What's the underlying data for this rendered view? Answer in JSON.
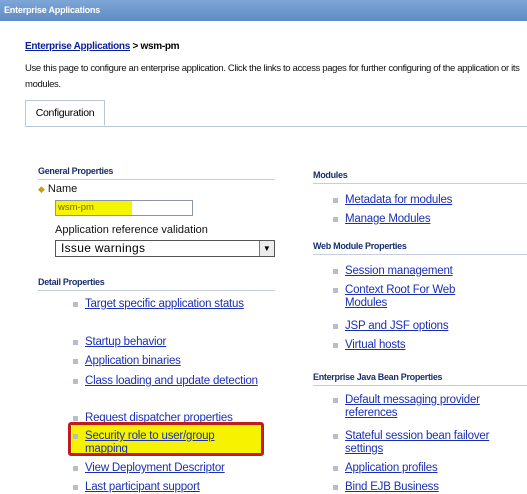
{
  "window": {
    "title": "Enterprise Applications"
  },
  "breadcrumb": {
    "link": "Enterprise Applications",
    "separator": " > ",
    "current": "wsm-pm"
  },
  "intro": "Use this page to configure an enterprise application. Click the links to access pages for further configuring of the application or its modules.",
  "tabs": [
    {
      "label": "Configuration"
    }
  ],
  "general": {
    "heading": "General Properties",
    "name_label": "Name",
    "name_value": "wsm-pm",
    "validation_label": "Application reference validation",
    "validation_value": "Issue warnings"
  },
  "detail": {
    "heading": "Detail Properties",
    "items": [
      {
        "label": "Target specific application status"
      },
      {
        "label": "Startup behavior"
      },
      {
        "label": "Application binaries"
      },
      {
        "label": "Class loading and update detection"
      },
      {
        "label": "Request dispatcher properties"
      },
      {
        "label": "Security role to user/group mapping"
      },
      {
        "label": "View Deployment Descriptor"
      },
      {
        "label": "Last participant support"
      }
    ]
  },
  "modules": {
    "heading": "Modules",
    "items": [
      {
        "label": "Metadata for modules"
      },
      {
        "label": "Manage Modules"
      }
    ]
  },
  "web_module": {
    "heading": "Web Module Properties",
    "items": [
      {
        "label": "Session management"
      },
      {
        "label": "Context Root For Web Modules"
      },
      {
        "label": "JSP and JSF options"
      },
      {
        "label": "Virtual hosts"
      }
    ]
  },
  "ejb": {
    "heading": "Enterprise Java Bean Properties",
    "items": [
      {
        "label": "Default messaging provider references"
      },
      {
        "label": "Stateful session bean failover settings"
      },
      {
        "label": "Application profiles"
      },
      {
        "label": "Bind EJB Business"
      }
    ]
  },
  "colors": {
    "link": "#1b2fb5",
    "highlight": "#f7f300",
    "callout": "#c51a1a",
    "titlebar": "#6b96cc"
  }
}
